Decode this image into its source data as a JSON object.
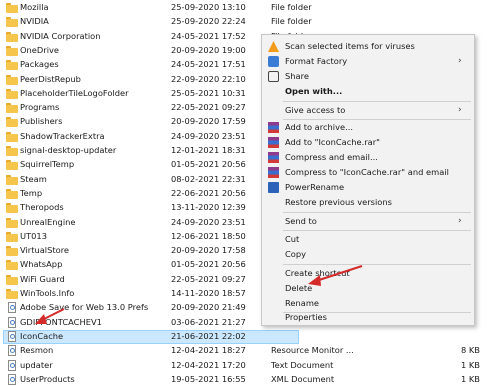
{
  "files": [
    {
      "name": "Mozilla",
      "date": "25-09-2020 13:10",
      "type": "File folder",
      "size": "",
      "kind": "folder"
    },
    {
      "name": "NVIDIA",
      "date": "25-09-2020 22:24",
      "type": "File folder",
      "size": "",
      "kind": "folder"
    },
    {
      "name": "NVIDIA Corporation",
      "date": "24-05-2021 17:52",
      "type": "File folder",
      "size": "",
      "kind": "folder"
    },
    {
      "name": "OneDrive",
      "date": "20-09-2020 19:00",
      "type": "",
      "size": "",
      "kind": "folder"
    },
    {
      "name": "Packages",
      "date": "24-05-2021 17:51",
      "type": "",
      "size": "",
      "kind": "folder"
    },
    {
      "name": "PeerDistRepub",
      "date": "22-09-2020 22:10",
      "type": "",
      "size": "",
      "kind": "folder"
    },
    {
      "name": "PlaceholderTileLogoFolder",
      "date": "25-05-2021 10:31",
      "type": "",
      "size": "",
      "kind": "folder"
    },
    {
      "name": "Programs",
      "date": "22-05-2021 09:27",
      "type": "",
      "size": "",
      "kind": "folder"
    },
    {
      "name": "Publishers",
      "date": "20-09-2020 17:59",
      "type": "",
      "size": "",
      "kind": "folder"
    },
    {
      "name": "ShadowTrackerExtra",
      "date": "24-09-2020 23:51",
      "type": "",
      "size": "",
      "kind": "folder"
    },
    {
      "name": "signal-desktop-updater",
      "date": "12-01-2021 18:31",
      "type": "",
      "size": "",
      "kind": "folder"
    },
    {
      "name": "SquirrelTemp",
      "date": "01-05-2021 20:56",
      "type": "",
      "size": "",
      "kind": "folder"
    },
    {
      "name": "Steam",
      "date": "08-02-2021 22:31",
      "type": "",
      "size": "",
      "kind": "folder"
    },
    {
      "name": "Temp",
      "date": "22-06-2021 20:56",
      "type": "",
      "size": "",
      "kind": "folder"
    },
    {
      "name": "Theropods",
      "date": "13-11-2020 12:39",
      "type": "",
      "size": "",
      "kind": "folder"
    },
    {
      "name": "UnrealEngine",
      "date": "24-09-2020 23:51",
      "type": "",
      "size": "",
      "kind": "folder"
    },
    {
      "name": "UT013",
      "date": "12-06-2021 18:50",
      "type": "",
      "size": "",
      "kind": "folder"
    },
    {
      "name": "VirtualStore",
      "date": "20-09-2020 17:58",
      "type": "",
      "size": "",
      "kind": "folder"
    },
    {
      "name": "WhatsApp",
      "date": "01-05-2021 20:56",
      "type": "",
      "size": "",
      "kind": "folder"
    },
    {
      "name": "WiFi Guard",
      "date": "22-05-2021 09:27",
      "type": "",
      "size": "",
      "kind": "folder"
    },
    {
      "name": "WinTools.Info",
      "date": "14-11-2020 18:57",
      "type": "",
      "size": "",
      "kind": "folder"
    },
    {
      "name": "Adobe Save for Web 13.0 Prefs",
      "date": "20-09-2020 21:49",
      "type": "",
      "size": "",
      "kind": "file"
    },
    {
      "name": "GDIPFONTCACHEV1",
      "date": "03-06-2021 21:27",
      "type": "",
      "size": "",
      "kind": "file"
    },
    {
      "name": "IconCache",
      "date": "21-06-2021 22:02",
      "type": "",
      "size": "",
      "kind": "file",
      "selected": true
    },
    {
      "name": "Resmon",
      "date": "12-04-2021 18:27",
      "type": "Resource Monitor ...",
      "size": "8 KB",
      "kind": "file"
    },
    {
      "name": "updater",
      "date": "12-04-2021 17:20",
      "type": "Text Document",
      "size": "1 KB",
      "kind": "file"
    },
    {
      "name": "UserProducts",
      "date": "19-05-2021 16:55",
      "type": "XML Document",
      "size": "1 KB",
      "kind": "file"
    }
  ],
  "context_menu": {
    "scan": "Scan selected items for viruses",
    "format_factory": "Format Factory",
    "share": "Share",
    "open_with": "Open with...",
    "give_access": "Give access to",
    "add_archive": "Add to archive...",
    "add_iconcache_rar": "Add to \"IconCache.rar\"",
    "compress_email": "Compress and email...",
    "compress_iconcache_email": "Compress to \"IconCache.rar\" and email",
    "power_rename": "PowerRename",
    "restore_versions": "Restore previous versions",
    "send_to": "Send to",
    "cut": "Cut",
    "copy": "Copy",
    "create_shortcut": "Create shortcut",
    "delete": "Delete",
    "rename": "Rename",
    "properties": "Properties"
  },
  "colors": {
    "selection_bg": "#cce8ff",
    "annotation_arrow": "#d42a2a"
  }
}
